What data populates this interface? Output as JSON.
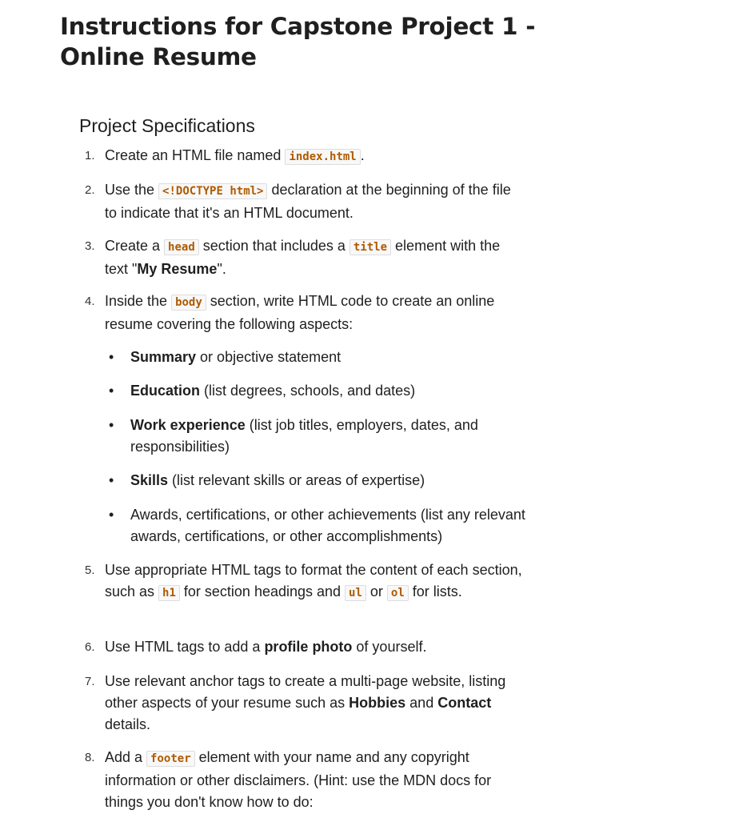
{
  "title": "Instructions for Capstone Project 1 - Online Resume",
  "section_heading": "Project Specifications",
  "steps": [
    {
      "n": "1.",
      "a": "Create an HTML file named ",
      "code1": "index.html",
      "b": "."
    },
    {
      "n": "2.",
      "a": "Use the ",
      "code1": "<!DOCTYPE html>",
      "b": " declaration at the beginning of the file to indicate that it's an HTML document."
    },
    {
      "n": "3.",
      "a": "Create a ",
      "code1": "head",
      "b": " section that includes a ",
      "code2": "title",
      "c": " element with the text \"",
      "bold1": "My Resume",
      "d": "\"."
    },
    {
      "n": "4.",
      "a": "Inside the ",
      "code1": "body",
      "b": " section, write HTML code to create an online resume covering the following aspects:"
    },
    {
      "n": "5.",
      "a": "Use appropriate HTML tags to format the content of each section, such as ",
      "code1": "h1",
      "b": " for section headings and ",
      "code2": "ul",
      "c": " or ",
      "code3": "ol",
      "d": " for lists."
    },
    {
      "n": "6.",
      "a": "Use HTML tags to add a ",
      "bold1": "profile photo",
      "b": " of yourself."
    },
    {
      "n": "7.",
      "a": "Use relevant anchor tags to create a multi-page website, listing other aspects of your resume such as ",
      "bold1": "Hobbies",
      "b": " and ",
      "bold2": "Contact",
      "c": " details."
    },
    {
      "n": "8.",
      "a": "Add a ",
      "code1": "footer",
      "b": " element with your name and any copyright information or other disclaimers. (Hint: use the MDN docs for things you don't know how to do:"
    }
  ],
  "aspects": [
    {
      "bullet": "•",
      "bold": "Summary",
      "rest": " or objective statement"
    },
    {
      "bullet": "•",
      "bold": "Education",
      "rest": " (list degrees, schools, and dates)"
    },
    {
      "bullet": "•",
      "bold": "Work experience",
      "rest": " (list job titles, employers, dates, and responsibilities)"
    },
    {
      "bullet": "•",
      "bold": "Skills",
      "rest": " (list relevant skills or areas of expertise)"
    },
    {
      "bullet": "•",
      "bold": "",
      "rest": "Awards, certifications, or other achievements (list any relevant awards, certifications, or other accomplishments)"
    }
  ]
}
